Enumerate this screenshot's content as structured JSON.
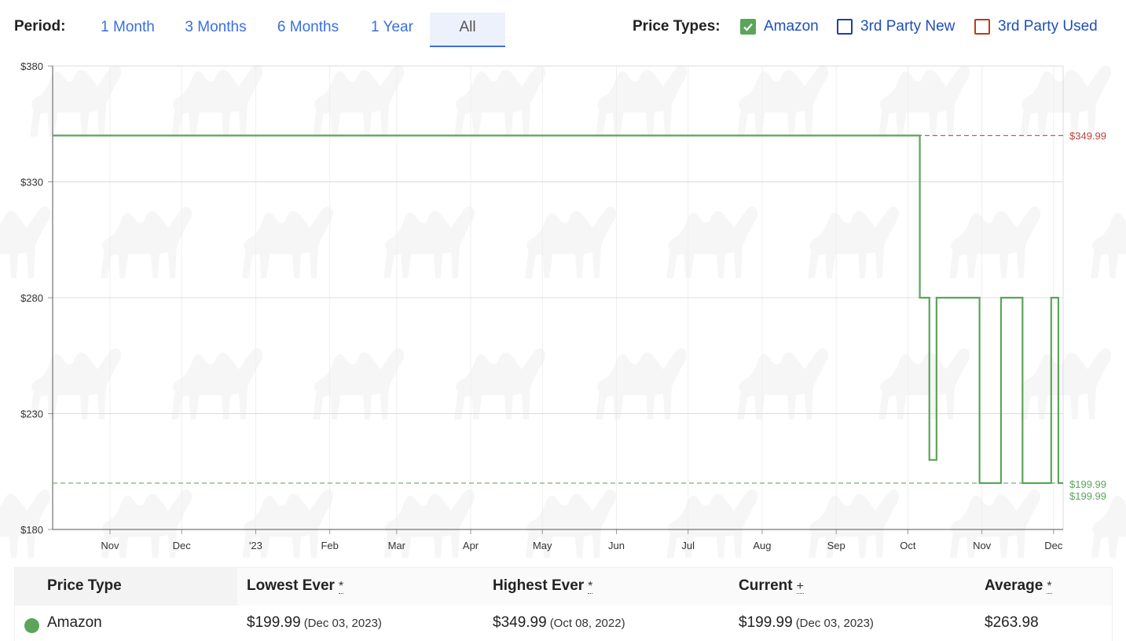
{
  "period": {
    "label": "Period:",
    "options": [
      "1 Month",
      "3 Months",
      "6 Months",
      "1 Year",
      "All"
    ],
    "selected": "All"
  },
  "price_types": {
    "label": "Price Types:",
    "items": [
      {
        "label": "Amazon",
        "checked": true,
        "color": "#5ba55b"
      },
      {
        "label": "3rd Party New",
        "checked": false,
        "color": "#1f3fa8"
      },
      {
        "label": "3rd Party Used",
        "checked": false,
        "color": "#c0391b"
      }
    ]
  },
  "chart_data": {
    "type": "line",
    "title": "",
    "xlabel": "",
    "ylabel": "",
    "ylim": [
      180,
      380
    ],
    "y_ticks": [
      "$180",
      "$230",
      "$280",
      "$330",
      "$380"
    ],
    "y_tick_values": [
      180,
      230,
      280,
      330,
      380
    ],
    "x_ticks": [
      "Nov",
      "Dec",
      "'23",
      "Feb",
      "Mar",
      "Apr",
      "May",
      "Jun",
      "Jul",
      "Aug",
      "Sep",
      "Oct",
      "Nov",
      "Dec"
    ],
    "x_tick_dates": [
      "2022-11-01",
      "2022-12-01",
      "2023-01-01",
      "2023-02-01",
      "2023-03-01",
      "2023-04-01",
      "2023-05-01",
      "2023-06-01",
      "2023-07-01",
      "2023-08-01",
      "2023-09-01",
      "2023-10-01",
      "2023-11-01",
      "2023-12-01"
    ],
    "xlim": [
      "2022-10-08",
      "2023-12-05"
    ],
    "grid": true,
    "series": [
      {
        "name": "Amazon",
        "color": "#5ba55b",
        "step": true,
        "points": [
          [
            "2022-10-08",
            349.99
          ],
          [
            "2023-10-06",
            279.99
          ],
          [
            "2023-10-10",
            209.99
          ],
          [
            "2023-10-13",
            279.99
          ],
          [
            "2023-10-31",
            199.99
          ],
          [
            "2023-11-09",
            279.99
          ],
          [
            "2023-11-18",
            199.99
          ],
          [
            "2023-11-30",
            279.99
          ],
          [
            "2023-12-03",
            276.99
          ],
          [
            "2023-12-03",
            199.99
          ],
          [
            "2023-12-05",
            199.99
          ]
        ]
      }
    ],
    "reference_lines": [
      {
        "value": 349.99,
        "label": "$349.99",
        "color": "#b5443a"
      },
      {
        "value": 199.99,
        "label": "$199.99",
        "color": "#5ba55b"
      }
    ],
    "right_labels": [
      {
        "text": "$349.99",
        "color": "#b5443a"
      },
      {
        "text": "$199.99",
        "color": "#5ba55b"
      },
      {
        "text": "$199.99",
        "color": "#5ba55b"
      }
    ]
  },
  "table": {
    "headers": [
      {
        "label": "Price Type",
        "mark": ""
      },
      {
        "label": "Lowest Ever",
        "mark": "*"
      },
      {
        "label": "Highest Ever",
        "mark": "*"
      },
      {
        "label": "Current",
        "mark": "+"
      },
      {
        "label": "Average",
        "mark": "*"
      }
    ],
    "rows": [
      {
        "type": "Amazon",
        "color": "#5ba55b",
        "lowest": "$199.99",
        "lowest_date": "(Dec 03, 2023)",
        "highest": "$349.99",
        "highest_date": "(Oct 08, 2022)",
        "current": "$199.99",
        "current_date": "(Dec 03, 2023)",
        "average": "$263.98"
      }
    ]
  }
}
